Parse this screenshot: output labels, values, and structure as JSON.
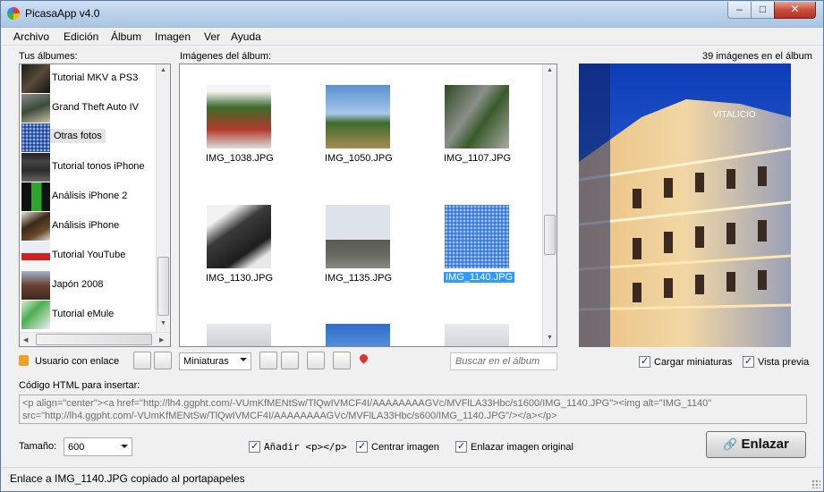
{
  "window": {
    "title": "PicasaApp v4.0"
  },
  "menu": [
    "Archivo",
    "Edición",
    "Álbum",
    "Imagen",
    "Ver",
    "Ayuda"
  ],
  "albums_label": "Tus álbumes:",
  "albums": [
    {
      "name": "Tutorial MKV a PS3"
    },
    {
      "name": "Grand Theft Auto IV"
    },
    {
      "name": "Otras fotos",
      "selected": true
    },
    {
      "name": "Tutorial tonos iPhone"
    },
    {
      "name": "Análisis iPhone 2"
    },
    {
      "name": "Análisis iPhone"
    },
    {
      "name": "Tutorial YouTube"
    },
    {
      "name": "Japón 2008"
    },
    {
      "name": "Tutorial eMule"
    }
  ],
  "images_label": "Imágenes del álbum:",
  "images": [
    {
      "name": "IMG_1038.JPG"
    },
    {
      "name": "IMG_1050.JPG"
    },
    {
      "name": "IMG_1107.JPG"
    },
    {
      "name": "IMG_1130.JPG"
    },
    {
      "name": "IMG_1135.JPG"
    },
    {
      "name": "IMG_1140.JPG",
      "selected": true
    }
  ],
  "image_count": "39 imágenes en el álbum",
  "preview_sign": "VITALICIO",
  "login": {
    "label": "Usuario con enlace"
  },
  "view_mode": "Miniaturas",
  "search_placeholder": "Buscar en el álbum",
  "load_thumbs": "Cargar miniaturas",
  "preview_check": "Vista previa",
  "html_label": "Código HTML para insertar:",
  "html_line1": "<p align=\"center\"><a href=\"http://lh4.ggpht.com/-VUmKfMENtSw/TlQwIVMCF4I/AAAAAAAAGVc/MVFlLA33Hbc/s1600/IMG_1140.JPG\"><img alt=\"IMG_1140\"",
  "html_line2": "src=\"http://lh4.ggpht.com/-VUmKfMENtSw/TlQwIVMCF4I/AAAAAAAAGVc/MVFlLA33Hbc/s600/IMG_1140.JPG\"/></a></p>",
  "size_label": "Tamaño:",
  "size_value": "600",
  "opt_add_p": "Añadir <p></p>",
  "opt_center": "Centrar imagen",
  "opt_link": "Enlazar imagen original",
  "enlazar_button": "Enlazar",
  "status": "Enlace a IMG_1140.JPG copiado al portapapeles",
  "colors": {
    "selection": "#3399ff",
    "title_gradient_top": "#cfe0f2",
    "close_button": "#c75040"
  }
}
